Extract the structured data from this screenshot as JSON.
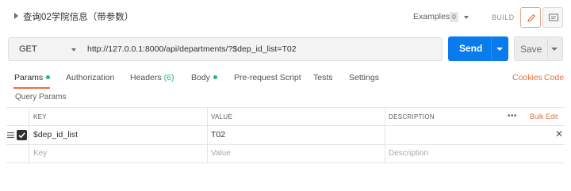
{
  "request": {
    "title": "查询02学院信息（带参数）",
    "examples_label": "Examples",
    "examples_count": "0",
    "build_label": "BUILD",
    "method": "GET",
    "url": "http://127.0.0.1:8000/api/departments/?$dep_id_list=T02",
    "send_label": "Send",
    "save_label": "Save"
  },
  "tabs": [
    {
      "label": "Params",
      "active": true
    },
    {
      "label": "Authorization"
    },
    {
      "label": "Headers",
      "count": "(6)"
    },
    {
      "label": "Body"
    },
    {
      "label": "Pre-request Script"
    },
    {
      "label": "Tests"
    },
    {
      "label": "Settings"
    }
  ],
  "links": {
    "cookies": "Cookies",
    "code": "Code"
  },
  "query_params": {
    "section_label": "Query Params",
    "headers": {
      "key": "KEY",
      "value": "VALUE",
      "description": "DESCRIPTION"
    },
    "more_icon": "more-horizontal-icon",
    "bulk_edit": "Bulk Edit",
    "rows": [
      {
        "key": "$dep_id_list",
        "value": "T02",
        "description": "",
        "checked": true
      }
    ],
    "placeholders": {
      "key": "Key",
      "value": "Value",
      "description": "Description"
    }
  },
  "colors": {
    "accent": "#f26b3a",
    "primary": "#097bed",
    "status_dot": "#26b47f",
    "link": "#e8703e"
  }
}
